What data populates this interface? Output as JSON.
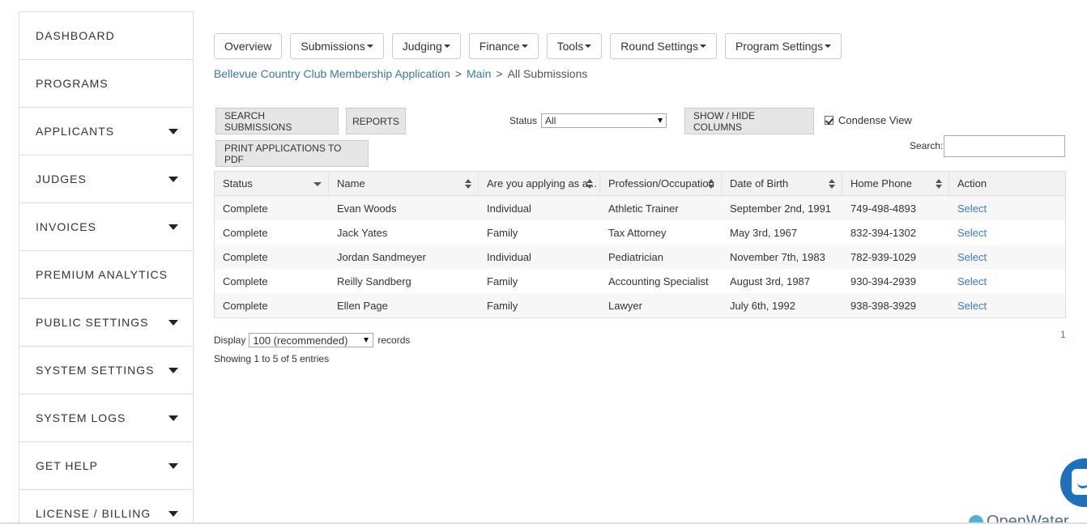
{
  "sidebar": {
    "items": [
      {
        "label": "DASHBOARD",
        "has_dropdown": false
      },
      {
        "label": "PROGRAMS",
        "has_dropdown": false
      },
      {
        "label": "APPLICANTS",
        "has_dropdown": true
      },
      {
        "label": "JUDGES",
        "has_dropdown": true
      },
      {
        "label": "INVOICES",
        "has_dropdown": true
      },
      {
        "label": "PREMIUM ANALYTICS",
        "has_dropdown": false
      },
      {
        "label": "PUBLIC SETTINGS",
        "has_dropdown": true
      },
      {
        "label": "SYSTEM SETTINGS",
        "has_dropdown": true
      },
      {
        "label": "SYSTEM LOGS",
        "has_dropdown": true
      },
      {
        "label": "GET HELP",
        "has_dropdown": true
      },
      {
        "label": "LICENSE / BILLING",
        "has_dropdown": true
      }
    ]
  },
  "topnav": {
    "overview": "Overview",
    "submissions": "Submissions",
    "judging": "Judging",
    "finance": "Finance",
    "tools": "Tools",
    "round_settings": "Round Settings",
    "program_settings": "Program Settings"
  },
  "breadcrumb": {
    "program": "Bellevue Country Club Membership Application",
    "round": "Main",
    "current": "All Submissions",
    "separator": ">"
  },
  "actions": {
    "search_submissions": "SEARCH SUBMISSIONS",
    "reports": "REPORTS",
    "print_pdf": "PRINT APPLICATIONS TO PDF",
    "show_hide_columns": "SHOW / HIDE COLUMNS",
    "status_label": "Status",
    "status_value": "All",
    "condense_label": "Condense View",
    "condense_checked": true,
    "search_label": "Search:",
    "search_value": ""
  },
  "table": {
    "columns": [
      "Status",
      "Name",
      "Are you applying as a...",
      "Profession/Occupation",
      "Date of Birth",
      "Home Phone",
      "Action"
    ],
    "rows": [
      [
        "Complete",
        "Evan Woods",
        "Individual",
        "Athletic Trainer",
        "September 2nd, 1991",
        "749-498-4893",
        "Select"
      ],
      [
        "Complete",
        "Jack Yates",
        "Family",
        "Tax Attorney",
        "May 3rd, 1967",
        "832-394-1302",
        "Select"
      ],
      [
        "Complete",
        "Jordan Sandmeyer",
        "Individual",
        "Pediatrician",
        "November 7th, 1983",
        "782-939-1029",
        "Select"
      ],
      [
        "Complete",
        "Reilly Sandberg",
        "Family",
        "Accounting Specialist",
        "August 3rd, 1987",
        "930-394-2939",
        "Select"
      ],
      [
        "Complete",
        "Ellen Page",
        "Family",
        "Lawyer",
        "July 6th, 1992",
        "938-398-3929",
        "Select"
      ]
    ]
  },
  "footer": {
    "display_label": "Display",
    "display_value": "100 (recommended)",
    "records_label": "records",
    "showing": "Showing 1 to 5 of 5 entries",
    "page": "1"
  },
  "brand": {
    "name": "OpenWater"
  },
  "colors": {
    "link": "#3a7aa0",
    "action_link": "#3a7ac9",
    "chat": "#1f6fbf"
  }
}
